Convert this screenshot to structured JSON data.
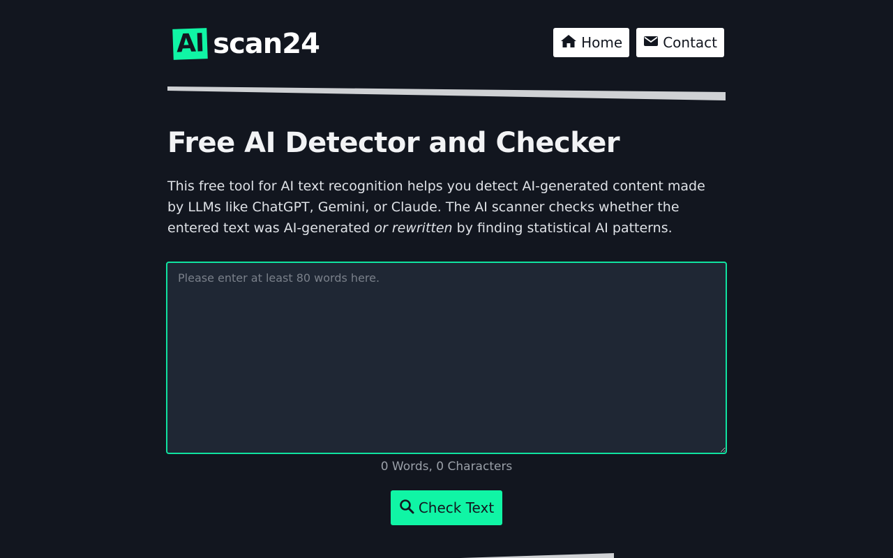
{
  "logo": {
    "badge": "AI",
    "text": "scan24"
  },
  "nav": {
    "home_label": "Home",
    "contact_label": "Contact"
  },
  "main": {
    "title": "Free AI Detector and Checker",
    "intro_part1": "This free tool for AI text recognition helps you detect AI-generated content made by LLMs like ChatGPT, Gemini, or Claude. The AI scanner checks whether the entered text was AI-generated ",
    "intro_em": "or rewritten",
    "intro_part2": " by finding statistical AI patterns.",
    "textarea_placeholder": "Please enter at least 80 words here.",
    "textarea_value": "",
    "counter": "0 Words, 0 Characters",
    "check_label": "Check Text"
  },
  "icons": {
    "home": "home-icon",
    "contact": "envelope-icon",
    "check": "search-icon"
  },
  "colors": {
    "background": "#12161f",
    "accent": "#10f5a5",
    "textarea_bg": "#1f2734",
    "divider": "#cfd1d4"
  }
}
